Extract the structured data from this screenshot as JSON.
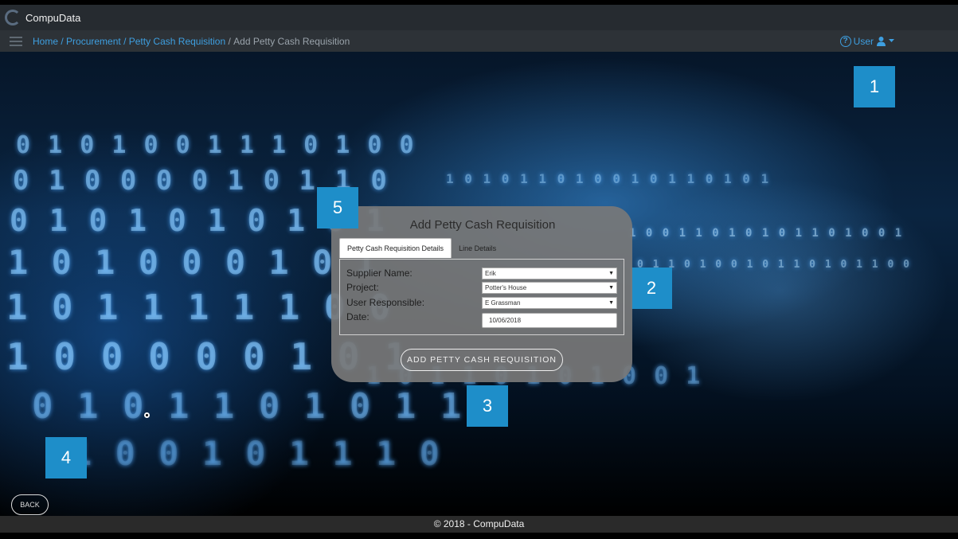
{
  "app": {
    "title": "CompuData"
  },
  "breadcrumb": {
    "items": [
      "Home",
      "Procurement",
      "Petty Cash Requisition"
    ],
    "current": "Add Petty Cash Requisition"
  },
  "user": {
    "label": "User",
    "help_icon": "question-circle-icon",
    "user_icon": "user-icon"
  },
  "dialog": {
    "title": "Add Petty Cash Requisition",
    "tabs": [
      {
        "label": "Petty Cash Requisition Details",
        "active": true
      },
      {
        "label": "Line Details",
        "active": false
      }
    ],
    "fields": {
      "supplier": {
        "label": "Supplier Name:",
        "value": "Erik"
      },
      "project": {
        "label": "Project:",
        "value": "Potter's House"
      },
      "user_responsible": {
        "label": "User Responsible:",
        "value": "E Grassman"
      },
      "date": {
        "label": "Date:",
        "value": "10/06/2018"
      }
    },
    "submit_label": "ADD PETTY CASH REQUISITION"
  },
  "markers": [
    "1",
    "2",
    "3",
    "4",
    "5"
  ],
  "back_label": "BACK",
  "footer": {
    "text": "© 2018 - CompuData"
  },
  "colors": {
    "accent": "#3e9fe0",
    "marker": "#1e8ec9"
  }
}
